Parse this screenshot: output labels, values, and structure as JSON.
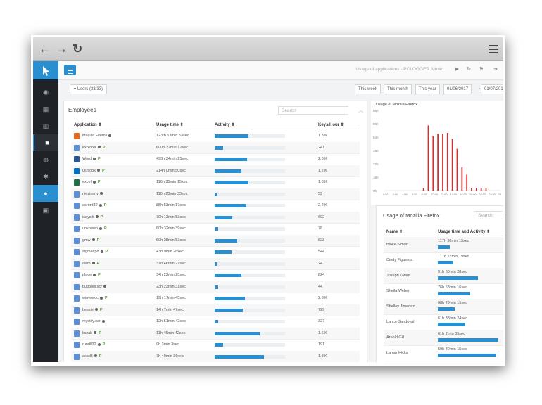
{
  "browser": {
    "back_icon": "arrow-left-icon",
    "forward_icon": "arrow-right-icon",
    "reload_icon": "reload-icon",
    "menu_icon": "menu-icon"
  },
  "topbar": {
    "title": "Usage of applications - PCLOGGER Admin"
  },
  "filters": {
    "users": "▾ Users  (33/33)",
    "this_week": "This week",
    "this_month": "This month",
    "this_year": "This year",
    "date_from": "01/06/2017",
    "date_sep": "-",
    "date_to": "01/07/2017"
  },
  "employees": {
    "title": "Employees",
    "search_placeholder": "Search",
    "columns": [
      "Application ⇕",
      "Usage time ⇕",
      "Activity ⇕",
      "Keys/Hour ⇕"
    ],
    "rows": [
      {
        "app": "Mozilla Firefox",
        "p": "",
        "time": "123th 53min 33sec",
        "activity": 0.48,
        "keys": "1.3 K",
        "color": "#e66a1f"
      },
      {
        "app": "explorer",
        "p": "P",
        "time": "600h 32min 12sec",
        "activity": 0.12,
        "keys": "241",
        "color": "#5b8fd6"
      },
      {
        "app": "Word",
        "p": "P",
        "time": "493h 34min 23sec",
        "activity": 0.46,
        "keys": "2.0 K",
        "color": "#2b5797"
      },
      {
        "app": "Outlook",
        "p": "P",
        "time": "214h 0min 50sec",
        "activity": 0.38,
        "keys": "1.2 K",
        "color": "#0072c6"
      },
      {
        "app": "excel",
        "p": "P",
        "time": "116h 35min 15sec",
        "activity": 0.48,
        "keys": "1.6 K",
        "color": "#1e7145"
      },
      {
        "app": "niezisany",
        "p": "",
        "time": "110h 23min 33sec",
        "activity": 0.03,
        "keys": "59",
        "color": "#5b8fd6"
      },
      {
        "app": "acrord32",
        "p": "P",
        "time": "85h 53min 17sec",
        "activity": 0.45,
        "keys": "2.2 K",
        "color": "#5b8fd6"
      },
      {
        "app": "isaysik",
        "p": "P",
        "time": "79h 13min 53sec",
        "activity": 0.25,
        "keys": "692",
        "color": "#5b8fd6"
      },
      {
        "app": "unknown",
        "p": "P",
        "time": "60h 32min 39sec",
        "activity": 0.04,
        "keys": "78",
        "color": "#5b8fd6"
      },
      {
        "app": "gmw",
        "p": "P",
        "time": "60h 28min 53sec",
        "activity": 0.32,
        "keys": "823",
        "color": "#5b8fd6"
      },
      {
        "app": "sigmacpd",
        "p": "P",
        "time": "43h 9min 26sec",
        "activity": 0.24,
        "keys": "544",
        "color": "#5b8fd6"
      },
      {
        "app": "dwm",
        "p": "P",
        "time": "37h 46min 21sec",
        "activity": 0.03,
        "keys": "24",
        "color": "#5b8fd6"
      },
      {
        "app": "place",
        "p": "P",
        "time": "34h 22min 23sec",
        "activity": 0.38,
        "keys": "824",
        "color": "#5b8fd6"
      },
      {
        "app": "bubbles.scr",
        "p": "",
        "time": "23h 23min 31sec",
        "activity": 0.04,
        "keys": "44",
        "color": "#5b8fd6"
      },
      {
        "app": "winwordc",
        "p": "P",
        "time": "19h 17min 45sec",
        "activity": 0.43,
        "keys": "2.3 K",
        "color": "#5b8fd6"
      },
      {
        "app": "bessie",
        "p": "P",
        "time": "14h 7min 47sec",
        "activity": 0.4,
        "keys": "729",
        "color": "#5b8fd6"
      },
      {
        "app": "mystify.scr",
        "p": "",
        "time": "12h 51min 42sec",
        "activity": 0.04,
        "keys": "327",
        "color": "#5b8fd6"
      },
      {
        "app": "kszab",
        "p": "P",
        "time": "11h 45min 42sec",
        "activity": 0.64,
        "keys": "1.6 K",
        "color": "#5b8fd6"
      },
      {
        "app": "rundll32",
        "p": "P",
        "time": "9h 3min 3sec",
        "activity": 0.12,
        "keys": "191",
        "color": "#5b8fd6"
      },
      {
        "app": "acadlt",
        "p": "P",
        "time": "7h 49min 36sec",
        "activity": 0.7,
        "keys": "1.8 K",
        "color": "#5b8fd6"
      }
    ]
  },
  "chart_data": {
    "type": "bar",
    "title": "Usage of Mozilla Firefox",
    "xlabel": "",
    "ylabel": "",
    "y_tick_labels": [
      "0h",
      "16h",
      "32h",
      "48h",
      "64h",
      "80h",
      "96h"
    ],
    "ylim": [
      0,
      96
    ],
    "x_tick_labels": [
      "0:00",
      "2:00",
      "4:00",
      "6:00",
      "8:00",
      "10:00",
      "12:00",
      "14:00",
      "16:00",
      "18:00",
      "20:00",
      "22:00",
      "24"
    ],
    "x": [
      8,
      8.5,
      9,
      9.5,
      10,
      10.5,
      11,
      11.5,
      12,
      12.5,
      13,
      13.5,
      14,
      14.5,
      15,
      15.5,
      16,
      16.5,
      17,
      17.5,
      18,
      18.5,
      19,
      19.5,
      20,
      20.5,
      21
    ],
    "values": [
      3,
      0,
      78,
      0,
      65,
      0,
      68,
      0,
      68,
      0,
      69,
      0,
      62,
      0,
      50,
      0,
      28,
      0,
      19,
      0,
      3,
      0,
      3,
      0,
      3,
      0,
      3
    ],
    "bar_color": "#d0302f",
    "grid": false
  },
  "mozilla_table": {
    "title": "Usage of Mozilla Firefox",
    "search_placeholder": "Search",
    "columns": [
      "Name ⇕",
      "Usage time and Activity ⇕"
    ],
    "rows": [
      {
        "name": "Blake Simon",
        "time": "117h 30min 13sec",
        "activity": 0.18
      },
      {
        "name": "Cindy Figueroa",
        "time": "117h 27min 19sec",
        "activity": 0.24
      },
      {
        "name": "Joseph Owen",
        "time": "91h 30min 28sec",
        "activity": 0.62
      },
      {
        "name": "Sheila Weber",
        "time": "76h 53min 16sec",
        "activity": 0.5
      },
      {
        "name": "Shelley Jimenez",
        "time": "68h 29min 15sec",
        "activity": 0.26
      },
      {
        "name": "Lance Sandoval",
        "time": "61h 38min 24sec",
        "activity": 0.42
      },
      {
        "name": "Arnold Gill",
        "time": "61h 2min 35sec",
        "activity": 0.93
      },
      {
        "name": "Lamar Hicks",
        "time": "59h 30min 15sec",
        "activity": 0.9
      }
    ]
  }
}
